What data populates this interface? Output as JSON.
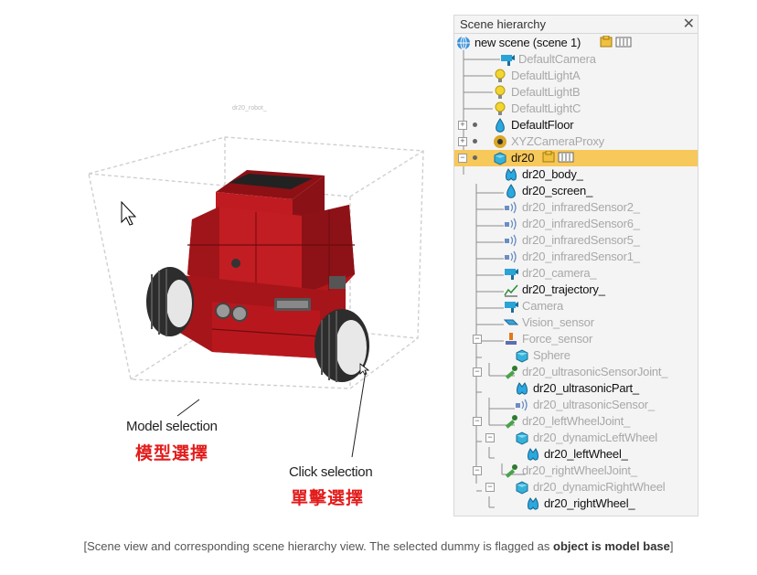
{
  "scene": {
    "robot_tag": "dr20_robot_",
    "labels": {
      "model_en": "Model selection",
      "model_zh": "模型選擇",
      "click_en": "Click selection",
      "click_zh": "單擊選擇"
    }
  },
  "hierarchy": {
    "title": "Scene hierarchy",
    "close": "✕",
    "rows": [
      {
        "label": "new scene (scene 1)",
        "icon": "globe-icon",
        "dim": false
      },
      {
        "label": "DefaultCamera",
        "icon": "camera-icon",
        "dim": true
      },
      {
        "label": "DefaultLightA",
        "icon": "light-icon",
        "dim": true
      },
      {
        "label": "DefaultLightB",
        "icon": "light-icon",
        "dim": true
      },
      {
        "label": "DefaultLightC",
        "icon": "light-icon",
        "dim": true
      },
      {
        "label": "DefaultFloor",
        "icon": "shape-icon",
        "dim": false
      },
      {
        "label": "XYZCameraProxy",
        "icon": "proxy-icon",
        "dim": true
      },
      {
        "label": "dr20",
        "icon": "model-base-icon",
        "dim": false,
        "selected": true
      },
      {
        "label": "dr20_body_",
        "icon": "shape-compound-icon",
        "dim": false
      },
      {
        "label": "dr20_screen_",
        "icon": "shape-icon",
        "dim": false
      },
      {
        "label": "dr20_infraredSensor2_",
        "icon": "proximity-sensor-icon",
        "dim": true
      },
      {
        "label": "dr20_infraredSensor6_",
        "icon": "proximity-sensor-icon",
        "dim": true
      },
      {
        "label": "dr20_infraredSensor5_",
        "icon": "proximity-sensor-icon",
        "dim": true
      },
      {
        "label": "dr20_infraredSensor1_",
        "icon": "proximity-sensor-icon",
        "dim": true
      },
      {
        "label": "dr20_camera_",
        "icon": "camera-icon",
        "dim": true
      },
      {
        "label": "dr20_trajectory_",
        "icon": "graph-icon",
        "dim": false
      },
      {
        "label": "Camera",
        "icon": "camera-icon",
        "dim": true
      },
      {
        "label": "Vision_sensor",
        "icon": "vision-sensor-icon",
        "dim": true
      },
      {
        "label": "Force_sensor",
        "icon": "force-sensor-icon",
        "dim": true
      },
      {
        "label": "Sphere",
        "icon": "cube-icon",
        "dim": true
      },
      {
        "label": "dr20_ultrasonicSensorJoint_",
        "icon": "joint-icon",
        "dim": true
      },
      {
        "label": "dr20_ultrasonicPart_",
        "icon": "shape-compound-icon",
        "dim": false
      },
      {
        "label": "dr20_ultrasonicSensor_",
        "icon": "proximity-sensor-icon",
        "dim": true
      },
      {
        "label": "dr20_leftWheelJoint_",
        "icon": "joint-icon",
        "dim": true
      },
      {
        "label": "dr20_dynamicLeftWheel",
        "icon": "cube-icon",
        "dim": true
      },
      {
        "label": "dr20_leftWheel_",
        "icon": "shape-compound-icon",
        "dim": false
      },
      {
        "label": "dr20_rightWheelJoint_",
        "icon": "joint-icon",
        "dim": true
      },
      {
        "label": "dr20_dynamicRightWheel",
        "icon": "cube-icon",
        "dim": true
      },
      {
        "label": "dr20_rightWheel_",
        "icon": "shape-compound-icon",
        "dim": false
      }
    ]
  },
  "caption": {
    "before": "[Scene view and corresponding scene hierarchy view. The selected dummy is flagged as ",
    "bold": "object is model base",
    "after": "]"
  },
  "colors": {
    "selection": "#f7c85a",
    "robot_red": "#b3161b",
    "accent_label": "#e31c1c"
  }
}
